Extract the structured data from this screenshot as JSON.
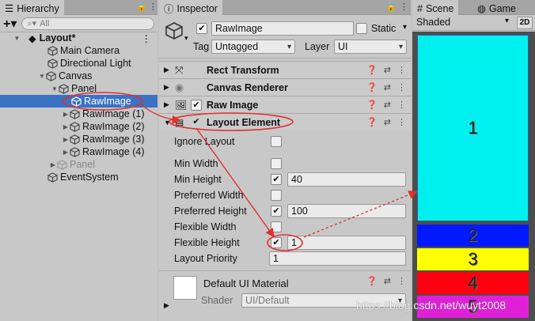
{
  "hierarchy": {
    "tab": "Hierarchy",
    "search_placeholder": "All",
    "items": [
      {
        "label": "Layout*",
        "bold": true
      },
      {
        "label": "Main Camera"
      },
      {
        "label": "Directional Light"
      },
      {
        "label": "Canvas"
      },
      {
        "label": "Panel"
      },
      {
        "label": "RawImage"
      },
      {
        "label": "RawImage (1)"
      },
      {
        "label": "RawImage (2)"
      },
      {
        "label": "RawImage (3)"
      },
      {
        "label": "RawImage (4)"
      },
      {
        "label": "Panel"
      },
      {
        "label": "EventSystem"
      }
    ]
  },
  "inspector": {
    "tab": "Inspector",
    "object_name": "RawImage",
    "static_label": "Static",
    "tag_label": "Tag",
    "tag_value": "Untagged",
    "layer_label": "Layer",
    "layer_value": "UI",
    "components": [
      {
        "title": "Rect Transform",
        "icon": "rect-transform-icon"
      },
      {
        "title": "Canvas Renderer",
        "icon": "canvas-renderer-icon"
      },
      {
        "title": "Raw Image",
        "icon": "raw-image-icon"
      },
      {
        "title": "Layout Element",
        "icon": "layout-element-icon"
      }
    ],
    "layout_element": {
      "ignore_layout": "Ignore Layout",
      "min_width": "Min Width",
      "min_height": "Min Height",
      "min_height_value": "40",
      "preferred_width": "Preferred Width",
      "preferred_height": "Preferred Height",
      "preferred_height_value": "100",
      "flexible_width": "Flexible Width",
      "flexible_height": "Flexible Height",
      "flexible_height_value": "1",
      "layout_priority": "Layout Priority",
      "layout_priority_value": "1"
    },
    "material": {
      "name": "Default UI Material",
      "shader_label": "Shader",
      "shader_value": "UI/Default"
    }
  },
  "scene": {
    "tab_scene": "Scene",
    "tab_game": "Game",
    "shading": "Shaded",
    "mode_2d": "2D",
    "blocks": [
      {
        "label": "1",
        "color": "#00f0f0"
      },
      {
        "label": "2",
        "color": "#0019ff"
      },
      {
        "label": "3",
        "color": "#ffff00"
      },
      {
        "label": "4",
        "color": "#ff0010"
      },
      {
        "label": "5",
        "color": "#e020d8"
      }
    ]
  },
  "watermark": "https://blog.csdn.net/wuyt2008",
  "colors": {
    "selection": "#3a72c4",
    "annotation": "#e03030"
  }
}
